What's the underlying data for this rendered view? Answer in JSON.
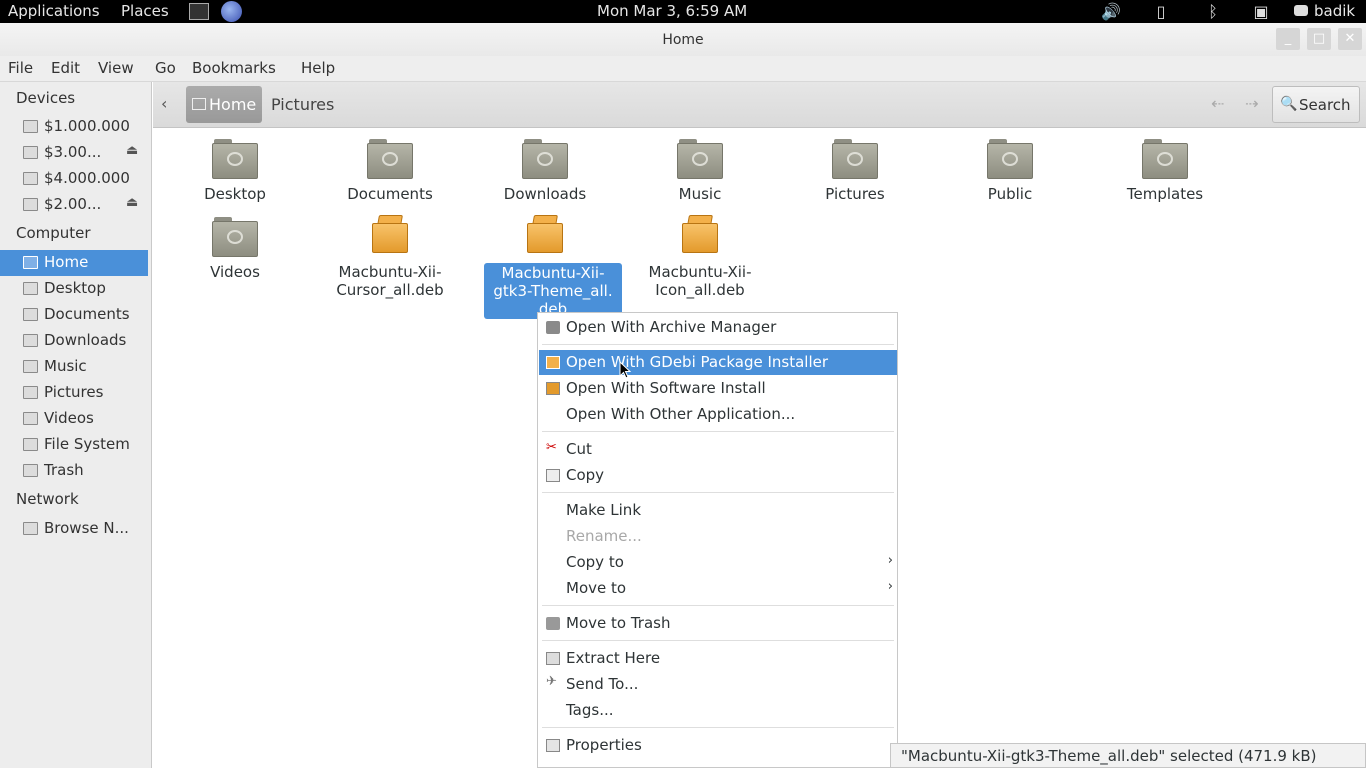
{
  "panel": {
    "applications": "Applications",
    "places": "Places",
    "clock": "Mon Mar  3,  6:59 AM",
    "user": "badik",
    "tray_icons": [
      "volume-icon",
      "battery-icon",
      "bluetooth-icon",
      "network-icon",
      "chat-icon"
    ]
  },
  "window": {
    "title": "Home",
    "controls": [
      "_",
      "□",
      "✕"
    ]
  },
  "menubar": [
    "File",
    "Edit",
    "View",
    "Go",
    "Bookmarks",
    "Help"
  ],
  "sidebar": {
    "devices_header": "Devices",
    "devices": [
      "$1.000.000",
      "$3.00...",
      "$4.000.000",
      "$2.00..."
    ],
    "computer_header": "Computer",
    "computer": [
      "Home",
      "Desktop",
      "Documents",
      "Downloads",
      "Music",
      "Pictures",
      "Videos",
      "File System",
      "Trash"
    ],
    "network_header": "Network",
    "network": [
      "Browse N..."
    ]
  },
  "pathbar": {
    "crumbs": [
      "Home",
      "Pictures"
    ],
    "search": "Search"
  },
  "files": [
    {
      "name": "Desktop",
      "kind": "folder"
    },
    {
      "name": "Documents",
      "kind": "folder"
    },
    {
      "name": "Downloads",
      "kind": "folder"
    },
    {
      "name": "Music",
      "kind": "folder"
    },
    {
      "name": "Pictures",
      "kind": "folder"
    },
    {
      "name": "Public",
      "kind": "folder"
    },
    {
      "name": "Templates",
      "kind": "folder"
    },
    {
      "name": "Videos",
      "kind": "folder"
    },
    {
      "line1": "Macbuntu-Xii-",
      "line2": "Cursor_all.deb",
      "kind": "package"
    },
    {
      "line1": "Macbuntu-Xii-",
      "line2": "gtk3-Theme_all.",
      "line3": "deb",
      "kind": "package",
      "selected": true
    },
    {
      "line1": "Macbuntu-Xii-",
      "line2": "Icon_all.deb",
      "kind": "package"
    }
  ],
  "context_menu": {
    "open_archive": "Open With Archive Manager",
    "open_gdebi": "Open With GDebi Package Installer",
    "open_software": "Open With Software Install",
    "open_other": "Open With Other Application...",
    "cut": "Cut",
    "copy": "Copy",
    "make_link": "Make Link",
    "rename": "Rename...",
    "copy_to": "Copy to",
    "move_to": "Move to",
    "move_trash": "Move to Trash",
    "extract": "Extract Here",
    "send_to": "Send To...",
    "tags": "Tags...",
    "properties": "Properties",
    "submenu_arrow": "›"
  },
  "status": "\"Macbuntu-Xii-gtk3-Theme_all.deb\" selected (471.9 kB)"
}
